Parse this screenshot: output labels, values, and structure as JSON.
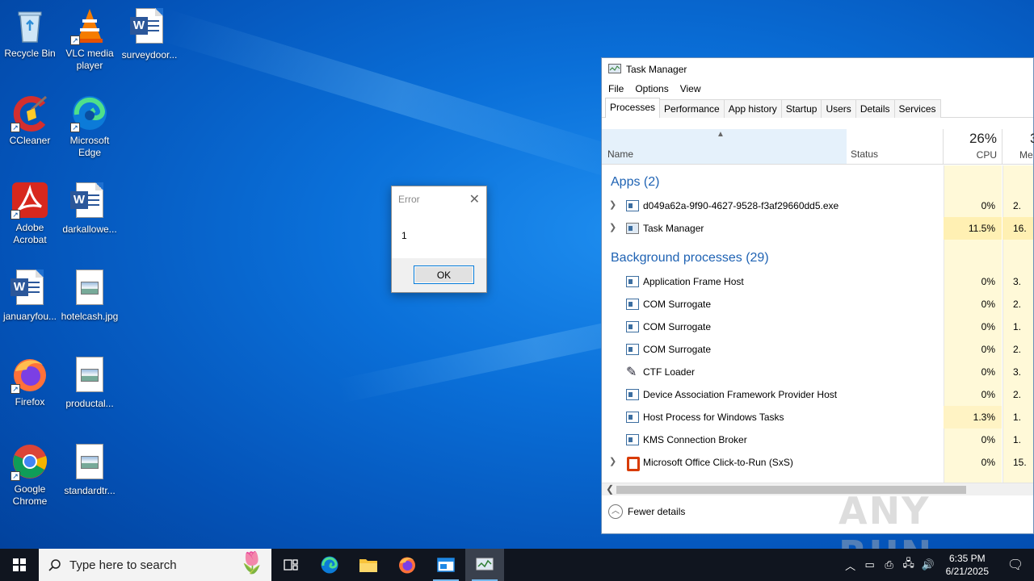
{
  "desktop": {
    "icons": [
      {
        "label": "Recycle Bin"
      },
      {
        "label": "VLC media player"
      },
      {
        "label": "surveydoor..."
      },
      {
        "label": "CCleaner"
      },
      {
        "label": "Microsoft Edge"
      },
      {
        "label": "Adobe Acrobat"
      },
      {
        "label": "darkallowe..."
      },
      {
        "label": "januaryfou..."
      },
      {
        "label": "hotelcash.jpg"
      },
      {
        "label": "Firefox"
      },
      {
        "label": "productal..."
      },
      {
        "label": "Google Chrome"
      },
      {
        "label": "standardtr..."
      }
    ]
  },
  "dialog": {
    "title": "Error",
    "message": "1",
    "ok_label": "OK"
  },
  "taskmanager": {
    "title": "Task Manager",
    "menu": [
      "File",
      "Options",
      "View"
    ],
    "tabs": [
      "Processes",
      "Performance",
      "App history",
      "Startup",
      "Users",
      "Details",
      "Services"
    ],
    "columns": {
      "name": "Name",
      "status": "Status",
      "cpu_pct": "26%",
      "cpu": "CPU",
      "mem_pct": "3",
      "mem": "Me"
    },
    "apps_header": "Apps (2)",
    "apps": [
      {
        "name": "d049a62a-9f90-4627-9528-f3af29660dd5.exe",
        "cpu": "0%",
        "mem": "2."
      },
      {
        "name": "Task Manager",
        "cpu": "11.5%",
        "mem": "16."
      }
    ],
    "bg_header": "Background processes (29)",
    "background": [
      {
        "name": "Application Frame Host",
        "cpu": "0%",
        "mem": "3."
      },
      {
        "name": "COM Surrogate",
        "cpu": "0%",
        "mem": "2."
      },
      {
        "name": "COM Surrogate",
        "cpu": "0%",
        "mem": "1."
      },
      {
        "name": "COM Surrogate",
        "cpu": "0%",
        "mem": "2."
      },
      {
        "name": "CTF Loader",
        "cpu": "0%",
        "mem": "3."
      },
      {
        "name": "Device Association Framework Provider Host",
        "cpu": "0%",
        "mem": "2."
      },
      {
        "name": "Host Process for Windows Tasks",
        "cpu": "1.3%",
        "mem": "1."
      },
      {
        "name": "KMS Connection Broker",
        "cpu": "0%",
        "mem": "1."
      },
      {
        "name": "Microsoft Office Click-to-Run (SxS)",
        "cpu": "0%",
        "mem": "15."
      }
    ],
    "footer": "Fewer details"
  },
  "watermark": "ANY RUN",
  "taskbar": {
    "search_placeholder": "Type here to search",
    "time": "6:35 PM",
    "date": "6/21/2025"
  }
}
